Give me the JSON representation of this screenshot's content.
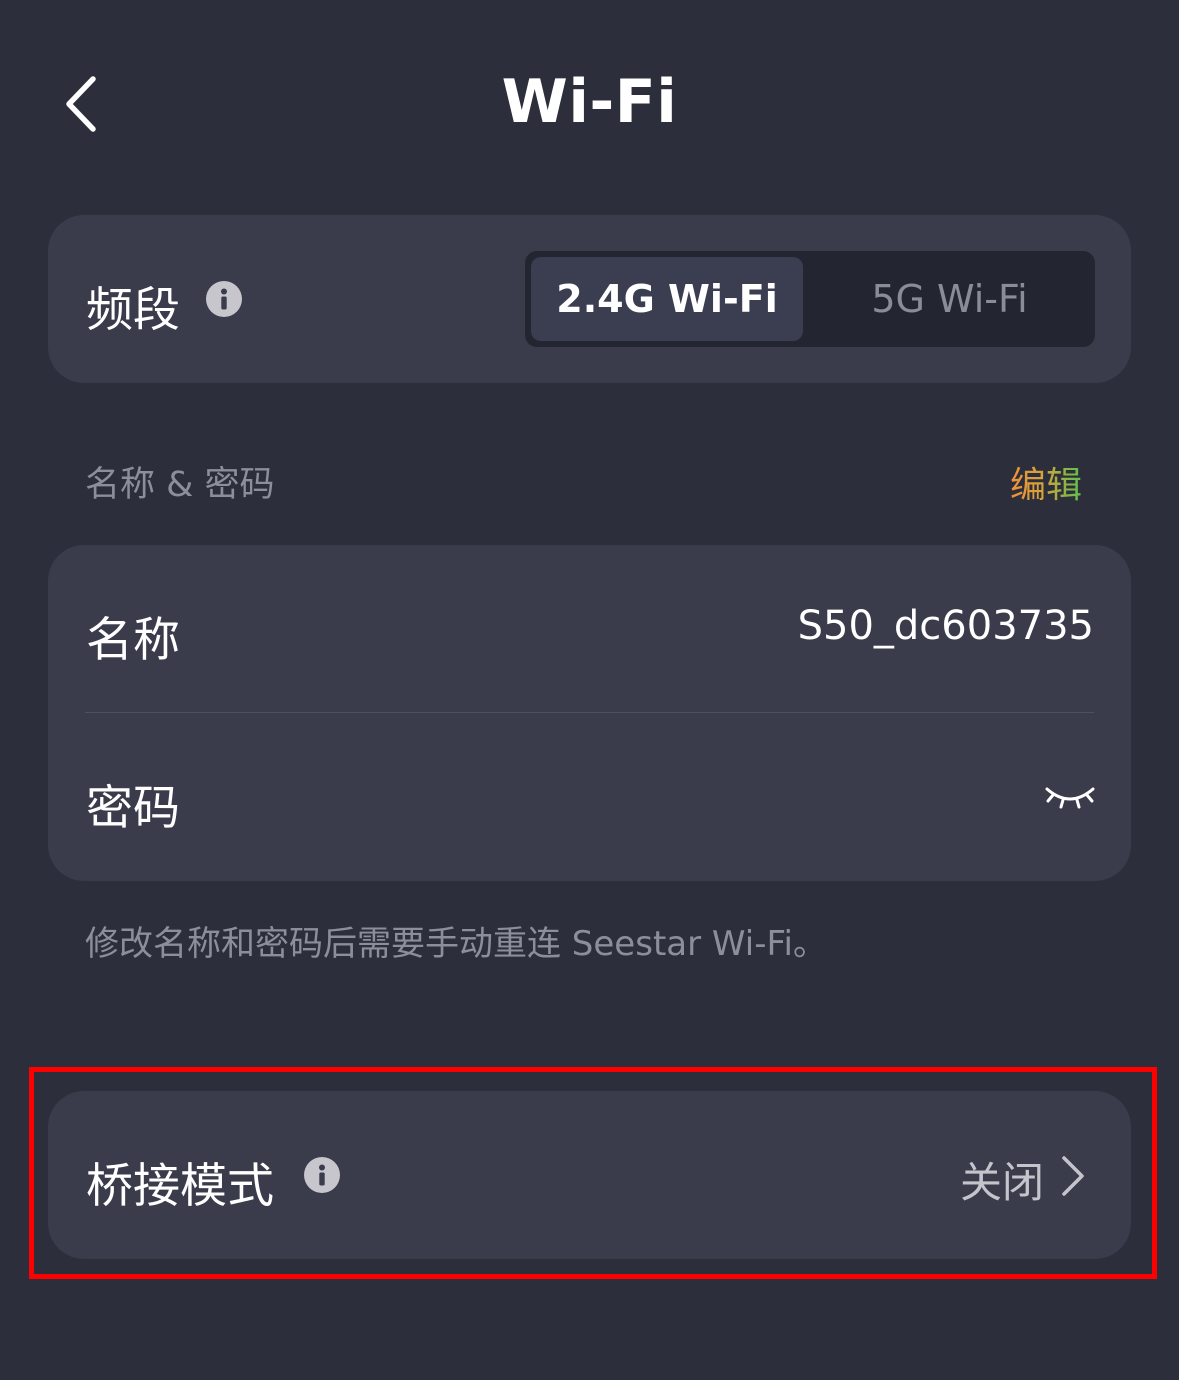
{
  "header": {
    "title": "Wi-Fi",
    "back_icon": "chevron-left-icon"
  },
  "band": {
    "label": "频段",
    "info_icon": "info-icon",
    "options": [
      "2.4G Wi-Fi",
      "5G Wi-Fi"
    ],
    "selected": "2.4G Wi-Fi"
  },
  "credentials": {
    "section_label": "名称 & 密码",
    "edit_label": "编辑",
    "name_label": "名称",
    "name_value": "S50_dc603735",
    "password_label": "密码",
    "password_icon": "eye-closed-icon",
    "hint": "修改名称和密码后需要手动重连 Seestar Wi-Fi。"
  },
  "bridge": {
    "label": "桥接模式",
    "info_icon": "info-icon",
    "status": "关闭",
    "chevron_icon": "chevron-right-icon"
  },
  "colors": {
    "background": "#2c2e3b",
    "card": "#3a3c4c",
    "highlight": "#ff0000",
    "edit_gradient": [
      "#f08f3a",
      "#5cc04c"
    ]
  }
}
